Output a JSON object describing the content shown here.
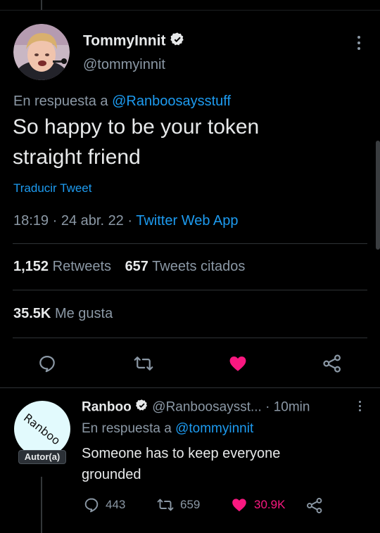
{
  "main_tweet": {
    "display_name": "TommyInnit",
    "handle": "@tommyinnit",
    "reply_prefix": "En respuesta a ",
    "reply_to": "@Ranboosaysstuff",
    "text_line1": "So happy to be your token",
    "text_line2": "straight friend",
    "translate": "Traducir Tweet",
    "time": "18:19",
    "sep1": " · ",
    "date": "24 abr. 22",
    "sep2": " · ",
    "source": "Twitter Web App",
    "retweets_count": "1,152",
    "retweets_label": "Retweets",
    "quotes_count": "657",
    "quotes_label": "Tweets citados",
    "likes_count": "35.5K",
    "likes_label": "Me gusta",
    "liked": true
  },
  "reply_tweet": {
    "display_name": "Ranboo",
    "handle": "@Ranboosaysst...",
    "time_ago": "· 10min",
    "reply_prefix": "En respuesta a ",
    "reply_to": "@tommyinnit",
    "text_line1": "Someone has to keep everyone",
    "text_line2": "grounded",
    "avatar_text": "Ranboo",
    "author_badge": "Autor(a)",
    "reply_count": "443",
    "retweet_count": "659",
    "like_count": "30.9K"
  },
  "colors": {
    "background": "#000000",
    "link": "#1d9bf0",
    "muted": "#8b98a5",
    "like": "#f91880"
  },
  "icons": [
    "verified-icon",
    "more-icon",
    "reply-icon",
    "retweet-icon",
    "like-icon",
    "share-icon"
  ]
}
